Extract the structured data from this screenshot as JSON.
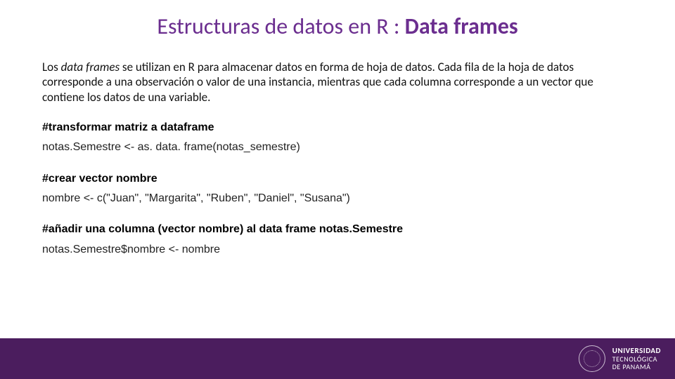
{
  "title": {
    "prefix": "Estructuras de datos en R : ",
    "bold": "Data frames"
  },
  "intro": {
    "lead_plain": "Los ",
    "lead_em": "data frames",
    "rest": " se utilizan en R para almacenar datos en forma de hoja de datos. Cada fila de la hoja de datos corresponde a una observación o valor de una instancia, mientras que cada columna corresponde a un vector que contiene los datos de una variable."
  },
  "blocks": [
    {
      "comment": "#transformar  matriz a dataframe",
      "code": "notas.Semestre <- as. data. frame(notas_semestre)"
    },
    {
      "comment": "#crear vector nombre",
      "code": "nombre <- c(\"Juan\", \"Margarita\", \"Ruben\", \"Daniel\", \"Susana\")"
    },
    {
      "comment": "#añadir una columna (vector nombre) al data frame notas.Semestre",
      "code": "notas.Semestre$nombre <- nombre"
    }
  ],
  "footer": {
    "line1": "UNIVERSIDAD",
    "line2": "TECNOLÓGICA",
    "line3": "DE PANAMÁ"
  }
}
